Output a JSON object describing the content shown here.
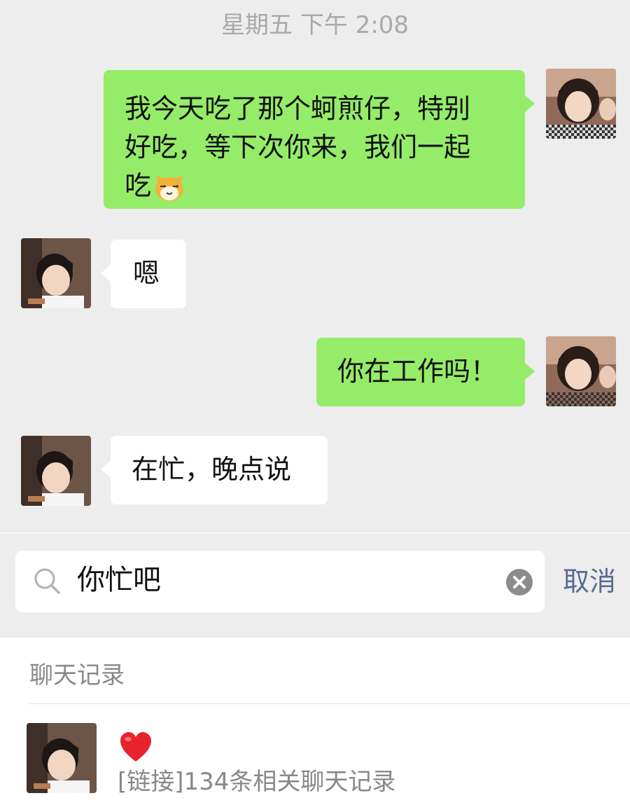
{
  "chat": {
    "timestamp": "星期五 下午 2:08",
    "messages": [
      {
        "side": "sent",
        "lines": [
          "我今天吃了那个蚵煎仔，特别",
          "好吃，等下次你来，我们一起",
          "吃"
        ],
        "emoji": "cat-face-emoji"
      },
      {
        "side": "recv",
        "text": "嗯"
      },
      {
        "side": "sent",
        "text": "你在工作吗！"
      },
      {
        "side": "recv",
        "text": "在忙，晚点说"
      }
    ]
  },
  "search": {
    "query": "你忙吧",
    "cancel_label": "取消",
    "icons": {
      "search": "search-icon",
      "clear": "clear-icon"
    }
  },
  "results": {
    "section_title": "聊天记录",
    "items": [
      {
        "title_icon": "heart-icon",
        "description": "[链接]134条相关聊天记录"
      }
    ]
  },
  "colors": {
    "sent_bubble": "#95ec69",
    "recv_bubble": "#ffffff",
    "background": "#ededed",
    "cancel_link": "#576b95",
    "heart": "#e8232e"
  }
}
